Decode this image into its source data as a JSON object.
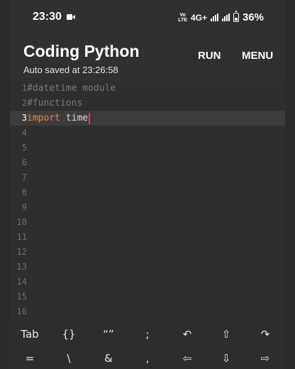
{
  "status": {
    "time": "23:30",
    "volte": "VoLTE",
    "network": "4G+",
    "battery": "36%"
  },
  "appbar": {
    "title": "Coding Python",
    "subtitle": "Auto saved at 23:26:58",
    "run_label": "RUN",
    "menu_label": "MENU"
  },
  "editor": {
    "current_line": 3,
    "line_numbers": [
      "1",
      "2",
      "3",
      "4",
      "5",
      "6",
      "7",
      "8",
      "9",
      "10",
      "11",
      "12",
      "13",
      "14",
      "15",
      "16"
    ],
    "code": {
      "line1": "#datetime module",
      "line2": "#functions",
      "line3_keyword": "import",
      "line3_name": "time"
    }
  },
  "keyboard": {
    "row1": [
      "Tab",
      "{}",
      "“”",
      ";",
      "↶",
      "⇧",
      "↷"
    ],
    "row2": [
      "=",
      "\\",
      "&",
      ",",
      "⇦",
      "⇩",
      "⇨"
    ]
  }
}
